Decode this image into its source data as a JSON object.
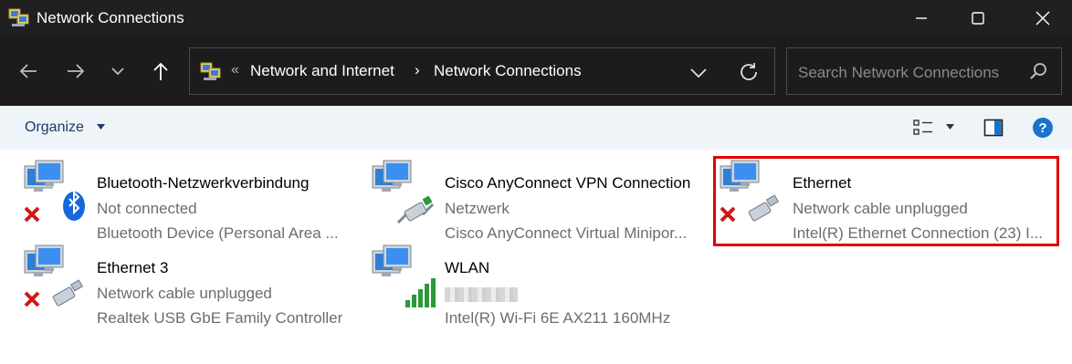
{
  "window": {
    "title": "Network Connections",
    "minimize_icon": "minimize-icon",
    "maximize_icon": "maximize-icon",
    "close_icon": "close-icon"
  },
  "nav": {
    "breadcrumb_overflow": "«",
    "breadcrumbs": [
      "Network and Internet",
      "Network Connections"
    ],
    "breadcrumb_separator": "›",
    "search_placeholder": "Search Network Connections"
  },
  "toolbar": {
    "organize_label": "Organize"
  },
  "connections": [
    {
      "name": "Bluetooth-Netzwerkverbindung",
      "status": "Not connected",
      "device": "Bluetooth Device (Personal Area ...",
      "icon": "bluetooth-adapter-icon",
      "disabled": true
    },
    {
      "name": "Cisco AnyConnect VPN Connection",
      "status": "Netzwerk",
      "device": "Cisco AnyConnect Virtual Minipor...",
      "icon": "network-adapter-icon",
      "disabled": false
    },
    {
      "name": "Ethernet",
      "status": "Network cable unplugged",
      "device": "Intel(R) Ethernet Connection (23) I...",
      "icon": "network-adapter-icon",
      "disabled": true,
      "highlighted": true
    },
    {
      "name": "Ethernet 3",
      "status": "Network cable unplugged",
      "device": "Realtek USB GbE Family Controller",
      "icon": "network-adapter-icon",
      "disabled": true
    },
    {
      "name": "WLAN",
      "status": "",
      "device": "Intel(R) Wi-Fi 6E AX211 160MHz",
      "icon": "wifi-adapter-icon",
      "disabled": false
    }
  ],
  "colors": {
    "titlebar": "#202020",
    "navbar": "#1c1c1c",
    "cmdbar": "#eff4f9",
    "highlight_border": "#e00000",
    "help_blue": "#1a73c9"
  }
}
